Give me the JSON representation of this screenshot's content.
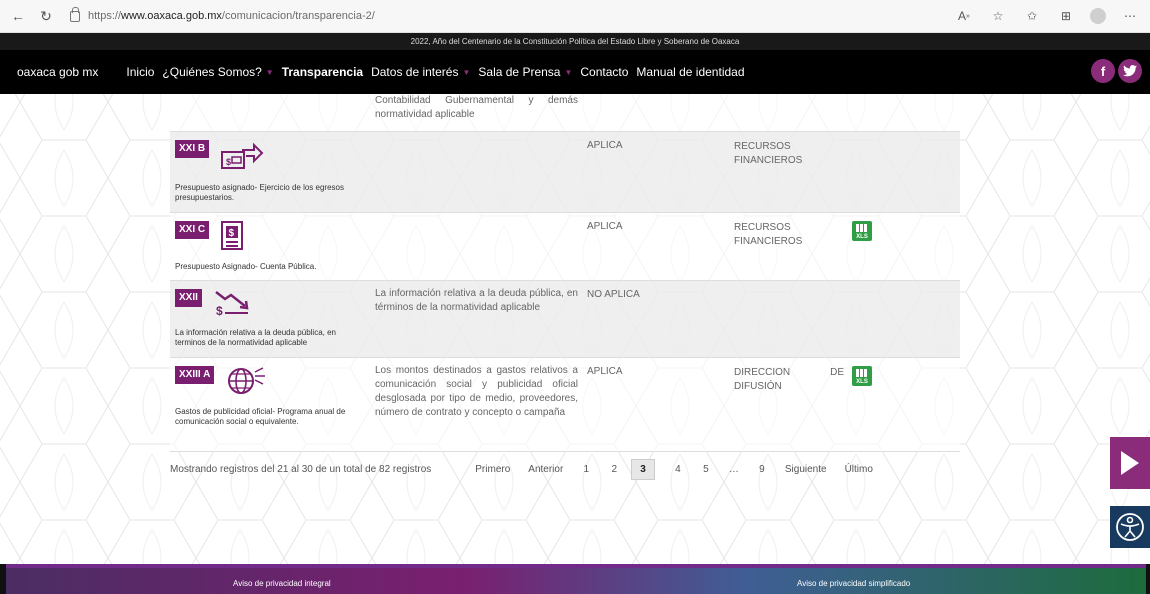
{
  "browser": {
    "url_prefix": "https://",
    "url_host": "www.oaxaca.gob.mx",
    "url_path": "/comunicacion/transparencia-2/"
  },
  "topstrip": {
    "text": "2022, Año del Centenario de la Constitución Política del Estado Libre y Soberano de Oaxaca"
  },
  "nav": {
    "brand": "oaxaca gob mx",
    "items": [
      {
        "label": "Inicio"
      },
      {
        "label": "¿Quiénes Somos?"
      },
      {
        "label": "Transparencia"
      },
      {
        "label": "Datos de interés"
      },
      {
        "label": "Sala de Prensa"
      },
      {
        "label": "Contacto"
      },
      {
        "label": "Manual de identidad"
      }
    ]
  },
  "table": {
    "rows": [
      {
        "badge": "",
        "title": "",
        "description": "Contabilidad Gubernamental y demás normatividad aplicable",
        "aplica": "",
        "area": "",
        "has_xls": false,
        "icon": "none"
      },
      {
        "badge": "XXI B",
        "title": "Presupuesto asignado- Ejercicio de los egresos presupuestarios.",
        "description": "",
        "aplica": "APLICA",
        "area": "RECURSOS FINANCIEROS",
        "has_xls": false,
        "icon": "money-transfer-icon"
      },
      {
        "badge": "XXI C",
        "title": "Presupuesto Asignado- Cuenta Pública.",
        "description": "",
        "aplica": "APLICA",
        "area": "RECURSOS FINANCIEROS",
        "has_xls": true,
        "icon": "budget-document-icon"
      },
      {
        "badge": "XXII",
        "title": "La información relativa a la deuda pública, en terminos de la normatividad aplicable",
        "description": "La información relativa a la deuda pública, en términos de la normatividad aplicable",
        "aplica": "NO APLICA",
        "area": "",
        "has_xls": false,
        "icon": "debt-decline-icon"
      },
      {
        "badge": "XXIII A",
        "title": "Gastos de publicidad oficial- Programa anual de comunicación social o equivalente.",
        "description": "Los montos destinados a gastos relativos a comunicación social y publicidad oficial desglosada por tipo de medio, proveedores, número de contrato y concepto o campaña",
        "aplica": "APLICA",
        "area": "DIRECCION DE DIFUSIÓN",
        "has_xls": true,
        "icon": "globe-megaphone-icon"
      }
    ],
    "xls_label": "XLS"
  },
  "pagination": {
    "info": "Mostrando registros del 21 al 30 de un total de 82 registros",
    "first": "Primero",
    "prev": "Anterior",
    "pages": [
      "1",
      "2",
      "3",
      "4",
      "5",
      "…",
      "9"
    ],
    "current": "3",
    "next": "Siguiente",
    "last": "Último"
  },
  "footer": {
    "left_link": "Aviso de privacidad integral",
    "right_link": "Aviso de privacidad simplificado"
  },
  "colors": {
    "brand_purple": "#7a1f70",
    "nav_bg": "#000000",
    "xls_green": "#2f9e45",
    "accessibility_blue": "#173a5e"
  }
}
